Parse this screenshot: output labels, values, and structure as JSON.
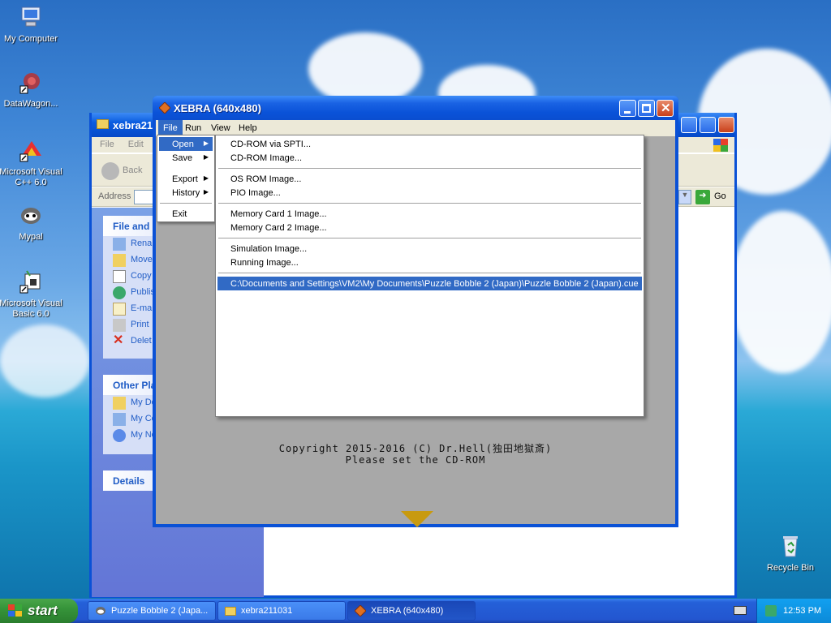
{
  "desktop": {
    "icons": [
      {
        "label": "My Computer",
        "icon": "my-computer-icon"
      },
      {
        "label": "DataWagon...",
        "icon": "datawagon-shortcut-icon"
      },
      {
        "label": "Microsoft Visual C++ 6.0",
        "icon": "visual-cpp-icon"
      },
      {
        "label": "Mypal",
        "icon": "mypal-icon"
      },
      {
        "label": "Microsoft Visual Basic 6.0",
        "icon": "visual-basic-icon"
      },
      {
        "label": "Recycle Bin",
        "icon": "recycle-bin-icon"
      }
    ]
  },
  "explorer": {
    "title": "xebra21",
    "menu": [
      "File",
      "Edit"
    ],
    "back_label": "Back",
    "address_label": "Address",
    "go_label": "Go",
    "file_tasks": {
      "header": "File and F",
      "items": [
        "Rena",
        "Move",
        "Copy",
        "Publis",
        "E-mai",
        "Print",
        "Delet"
      ]
    },
    "other_places": {
      "header": "Other Pla",
      "items": [
        "My Do",
        "My Co",
        "My Ne"
      ]
    },
    "details": {
      "header": "Details"
    }
  },
  "xebra": {
    "title": "XEBRA (640x480)",
    "menu": [
      "File",
      "Run",
      "View",
      "Help"
    ],
    "copyright_line1": "Copyright 2015-2016 (C) Dr.Hell(独田地獄斎)",
    "copyright_line2": "Please set the CD-ROM"
  },
  "file_menu": {
    "items": [
      "Open",
      "Save",
      "Export",
      "History",
      "Exit"
    ]
  },
  "open_submenu": {
    "items": [
      "CD-ROM via SPTI...",
      "CD-ROM Image...",
      "OS ROM Image...",
      "PIO Image...",
      "Memory Card 1 Image...",
      "Memory Card 2 Image...",
      "Simulation Image...",
      "Running Image...",
      "C:\\Documents and Settings\\VM2\\My Documents\\Puzzle Bobble 2 (Japan)\\Puzzle Bobble 2 (Japan).cue"
    ]
  },
  "taskbar": {
    "start_label": "start",
    "tasks": [
      "Puzzle Bobble 2 (Japa...",
      "xebra211031",
      "XEBRA (640x480)"
    ],
    "clock": "12:53 PM"
  },
  "colors": {
    "xp_blue": "#0a51d6",
    "menu_highlight": "#316ac5",
    "menu_bg": "#ece9d8",
    "client_gray": "#a8a8a8"
  }
}
